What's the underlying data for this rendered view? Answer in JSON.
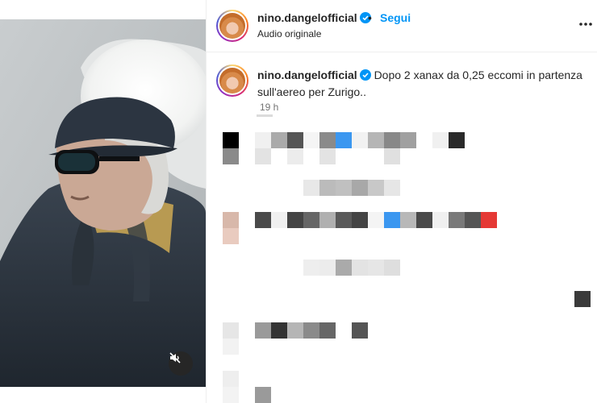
{
  "post": {
    "username": "nino.dangelofficial",
    "separator": "•",
    "follow_label": "Segui",
    "audio_label": "Audio originale"
  },
  "caption": {
    "username": "nino.dangelofficial",
    "text": "Dopo 2 xanax da 0,25 eccomi in partenza sull'aereo per Zurigo..",
    "timestamp": "19 h"
  },
  "icons": {
    "verified": "verified-badge-icon",
    "more": "more-options-icon",
    "mute": "speaker-muted-icon"
  },
  "colors": {
    "accent": "#0095f6",
    "verified": "#0095f6",
    "text": "#262626",
    "muted_text": "#737373"
  },
  "comments_pixelated": {
    "rows": [
      [
        "#000000",
        "#f5f5f5",
        "#aaaaaa",
        "#555555",
        "#f5f5f5",
        "#8a8a8a",
        "#3b97f0",
        "#f5f5f5",
        "#b0b0b0",
        "#8a8a8a",
        "#a0a0a0",
        "#f5f5f5",
        "#2a2a2a"
      ],
      [
        "#8a8a8a",
        "#dddddd",
        "#ffffff",
        "#dddddd",
        "#f0f0f0",
        "#dddddd",
        "#ffffff",
        "#f5f5f5",
        "#dddddd",
        "#ffffff"
      ]
    ]
  }
}
